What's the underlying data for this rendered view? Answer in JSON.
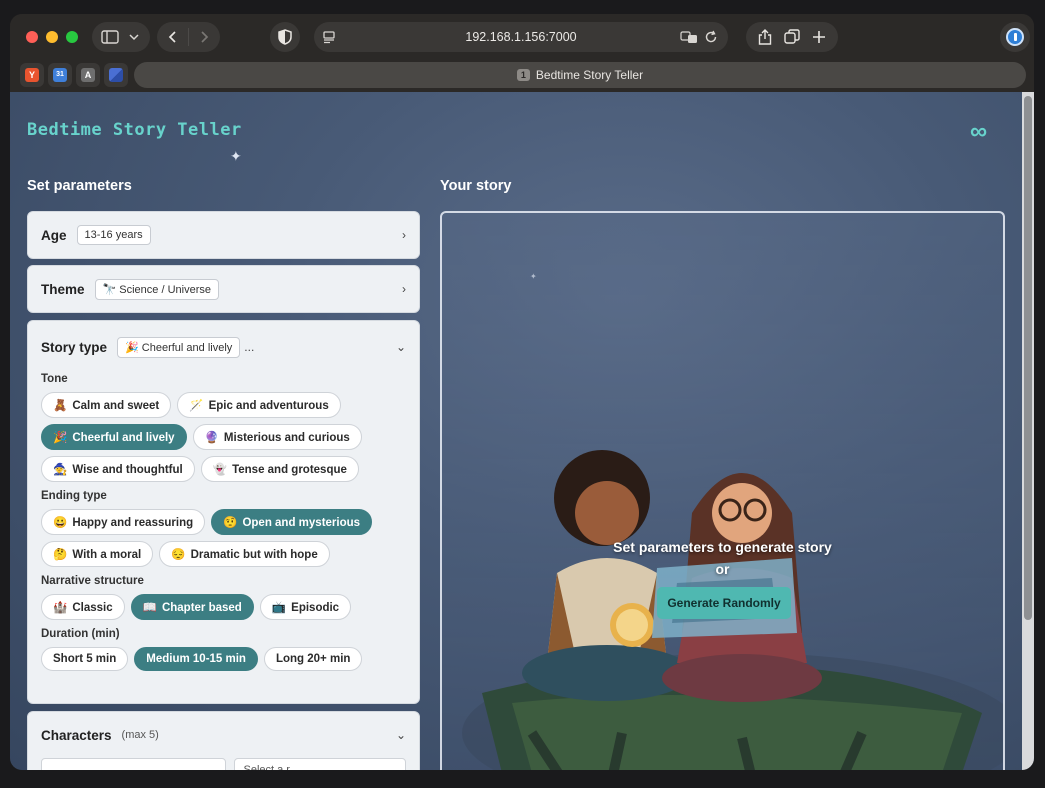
{
  "browser": {
    "address": "192.168.1.156:7000",
    "tab_number": "1",
    "tab_title": "Bedtime Story Teller",
    "favicons": [
      {
        "letter": "Y",
        "color": "#e8542f"
      },
      {
        "letter": "31",
        "color": "#3f7fd9"
      },
      {
        "letter": "A",
        "color": "#6e6e6e"
      },
      {
        "letter": "",
        "color": "#4a6fd3"
      }
    ]
  },
  "app": {
    "title": "Bedtime Story Teller",
    "infinity_glyph": "∞"
  },
  "left": {
    "heading": "Set parameters",
    "age": {
      "label": "Age",
      "value": "13-16 years",
      "chevron": "›"
    },
    "theme": {
      "label": "Theme",
      "value": "🔭 Science / Universe",
      "chevron": "›"
    },
    "story_type": {
      "label": "Story type",
      "value": "🎉 Cheerful and lively",
      "ellipsis": "...",
      "chevron": "⌄",
      "tone": {
        "label": "Tone",
        "chips": [
          {
            "emoji": "🧸",
            "text": "Calm and sweet",
            "selected": false
          },
          {
            "emoji": "🪄",
            "text": "Epic and adventurous",
            "selected": false
          },
          {
            "emoji": "🎉",
            "text": "Cheerful and lively",
            "selected": true
          },
          {
            "emoji": "🔮",
            "text": "Misterious and curious",
            "selected": false
          },
          {
            "emoji": "🧙",
            "text": "Wise and thoughtful",
            "selected": false
          },
          {
            "emoji": "👻",
            "text": "Tense and grotesque",
            "selected": false
          }
        ]
      },
      "ending": {
        "label": "Ending type",
        "chips": [
          {
            "emoji": "😀",
            "text": "Happy and reassuring",
            "selected": false
          },
          {
            "emoji": "🤨",
            "text": "Open and mysterious",
            "selected": true
          },
          {
            "emoji": "🤔",
            "text": "With a moral",
            "selected": false
          },
          {
            "emoji": "😔",
            "text": "Dramatic but with hope",
            "selected": false
          }
        ]
      },
      "narrative": {
        "label": "Narrative structure",
        "chips": [
          {
            "emoji": "🏰",
            "text": "Classic",
            "selected": false
          },
          {
            "emoji": "📖",
            "text": "Chapter based",
            "selected": true
          },
          {
            "emoji": "📺",
            "text": "Episodic",
            "selected": false
          }
        ]
      },
      "duration": {
        "label": "Duration (min)",
        "chips": [
          {
            "emoji": "",
            "text": "Short 5 min",
            "selected": false
          },
          {
            "emoji": "",
            "text": "Medium 10-15 min",
            "selected": true
          },
          {
            "emoji": "",
            "text": "Long 20+ min",
            "selected": false
          }
        ]
      }
    },
    "characters": {
      "label": "Characters",
      "hint": "(max 5)",
      "chevron": "⌄",
      "select_value": "Select a r..."
    }
  },
  "right": {
    "heading": "Your story",
    "message": "Set parameters to generate story",
    "or": "or",
    "button": "Generate Randomly"
  },
  "colors": {
    "accent": "#68d3cc",
    "chip_selected": "#3c7e83",
    "button": "#4fb8b1"
  }
}
